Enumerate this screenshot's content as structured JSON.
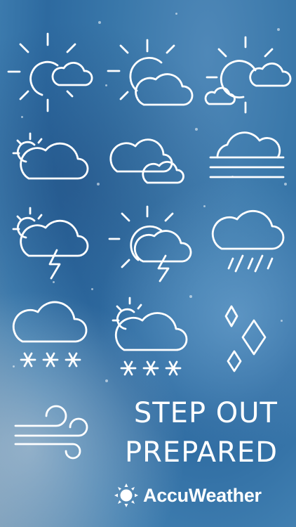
{
  "tagline": {
    "line1": "STEP OUT",
    "line2": "PREPARED"
  },
  "brand": {
    "name": "AccuWeather",
    "logo_icon": "sun-logo-icon"
  },
  "icons": [
    "partly-sunny-icon",
    "mostly-sunny-icon",
    "sunny-with-clouds-icon",
    "partly-cloudy-icon",
    "cloudy-icon",
    "fog-icon",
    "thunderstorm-icon",
    "sun-thunderstorm-icon",
    "rain-icon",
    "snow-icon",
    "sun-snow-icon",
    "ice-icon",
    "wind-icon"
  ],
  "colors": {
    "icon": "#ffffff",
    "background": "#3a78aa"
  }
}
